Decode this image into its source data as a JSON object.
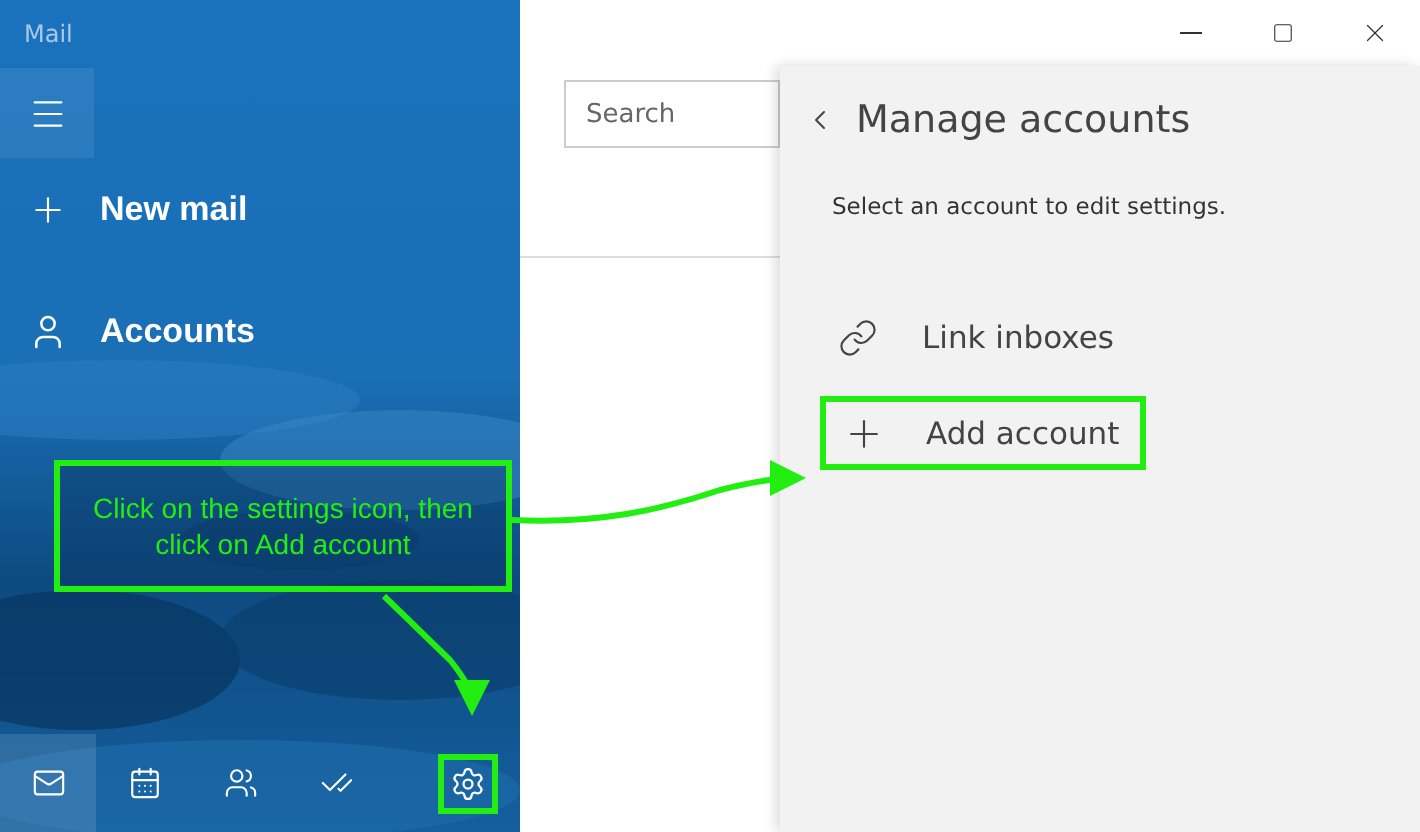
{
  "window": {
    "title": "Mail"
  },
  "nav": [
    {
      "kind": "new",
      "label": "New mail"
    },
    {
      "kind": "accounts",
      "label": "Accounts"
    }
  ],
  "bottom_bar": [
    {
      "kind": "mail",
      "selected": true,
      "highlighted": false
    },
    {
      "kind": "calendar",
      "selected": false,
      "highlighted": false
    },
    {
      "kind": "people",
      "selected": false,
      "highlighted": false
    },
    {
      "kind": "todo",
      "selected": false,
      "highlighted": false
    },
    {
      "kind": "settings",
      "selected": false,
      "highlighted": true
    }
  ],
  "search": {
    "placeholder": "Search"
  },
  "panel": {
    "title": "Manage accounts",
    "subtitle": "Select an account to edit settings.",
    "items": [
      {
        "kind": "link",
        "label": "Link inboxes",
        "highlighted": false
      },
      {
        "kind": "add",
        "label": "Add account",
        "highlighted": true
      }
    ]
  },
  "annotation": {
    "text": "Click on the settings icon, then click on Add account"
  }
}
